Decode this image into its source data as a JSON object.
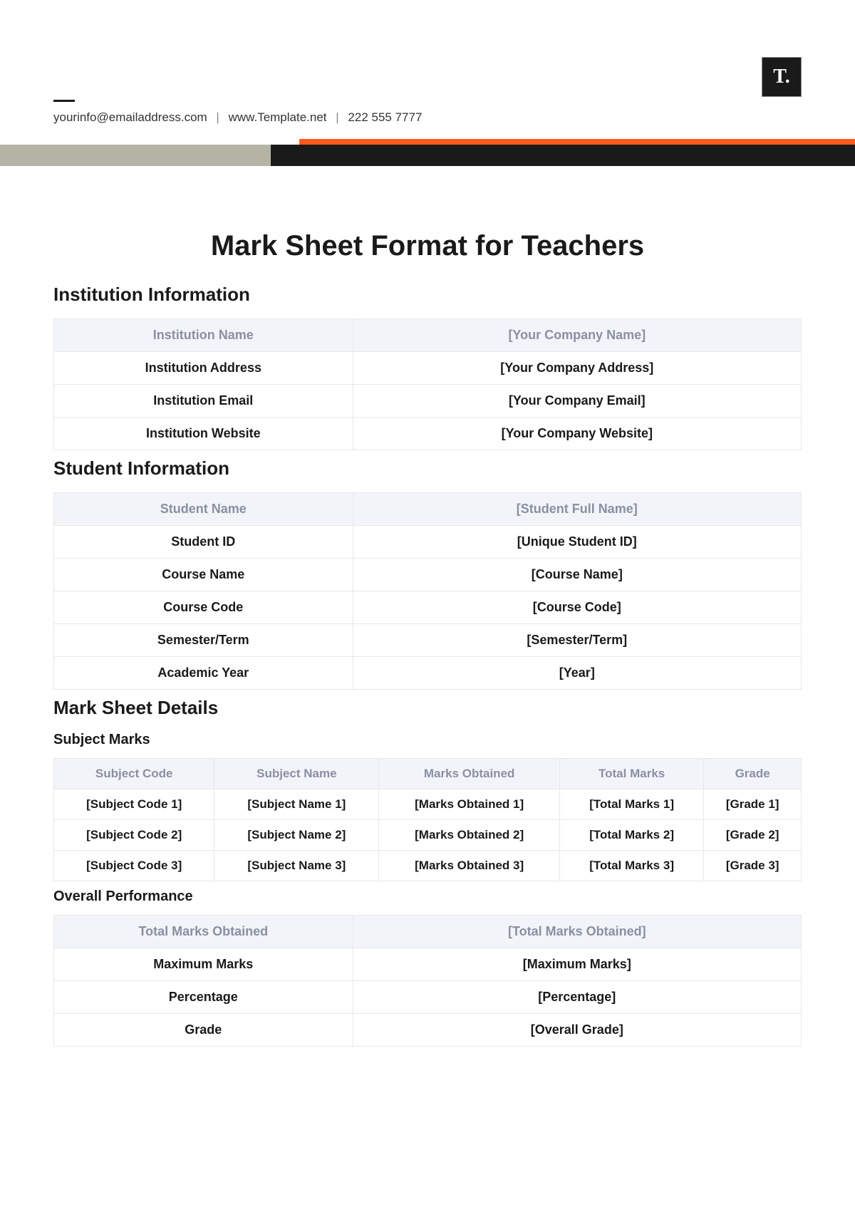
{
  "header": {
    "logo_text": "T.",
    "email": "yourinfo@emailaddress.com",
    "website": "www.Template.net",
    "phone": "222 555 7777"
  },
  "title": "Mark Sheet Format for Teachers",
  "sections": {
    "institution": {
      "heading": "Institution Information",
      "rows": [
        {
          "label": "Institution Name",
          "value": "[Your Company Name]"
        },
        {
          "label": "Institution Address",
          "value": "[Your Company Address]"
        },
        {
          "label": "Institution Email",
          "value": "[Your Company Email]"
        },
        {
          "label": "Institution Website",
          "value": "[Your Company Website]"
        }
      ]
    },
    "student": {
      "heading": "Student Information",
      "rows": [
        {
          "label": "Student Name",
          "value": "[Student Full Name]"
        },
        {
          "label": "Student ID",
          "value": "[Unique Student ID]"
        },
        {
          "label": "Course Name",
          "value": "[Course Name]"
        },
        {
          "label": "Course Code",
          "value": "[Course Code]"
        },
        {
          "label": "Semester/Term",
          "value": "[Semester/Term]"
        },
        {
          "label": "Academic Year",
          "value": "[Year]"
        }
      ]
    },
    "marksheet": {
      "heading": "Mark Sheet Details",
      "subject_marks": {
        "heading": "Subject Marks",
        "columns": [
          "Subject Code",
          "Subject Name",
          "Marks Obtained",
          "Total Marks",
          "Grade"
        ],
        "rows": [
          [
            "[Subject Code 1]",
            "[Subject Name 1]",
            "[Marks Obtained 1]",
            "[Total Marks 1]",
            "[Grade 1]"
          ],
          [
            "[Subject Code 2]",
            "[Subject Name 2]",
            "[Marks Obtained 2]",
            "[Total Marks 2]",
            "[Grade 2]"
          ],
          [
            "[Subject Code 3]",
            "[Subject Name 3]",
            "[Marks Obtained 3]",
            "[Total Marks 3]",
            "[Grade 3]"
          ]
        ]
      },
      "overall": {
        "heading": "Overall Performance",
        "rows": [
          {
            "label": "Total Marks Obtained",
            "value": "[Total Marks Obtained]"
          },
          {
            "label": "Maximum Marks",
            "value": "[Maximum Marks]"
          },
          {
            "label": "Percentage",
            "value": "[Percentage]"
          },
          {
            "label": "Grade",
            "value": "[Overall Grade]"
          }
        ]
      }
    }
  }
}
